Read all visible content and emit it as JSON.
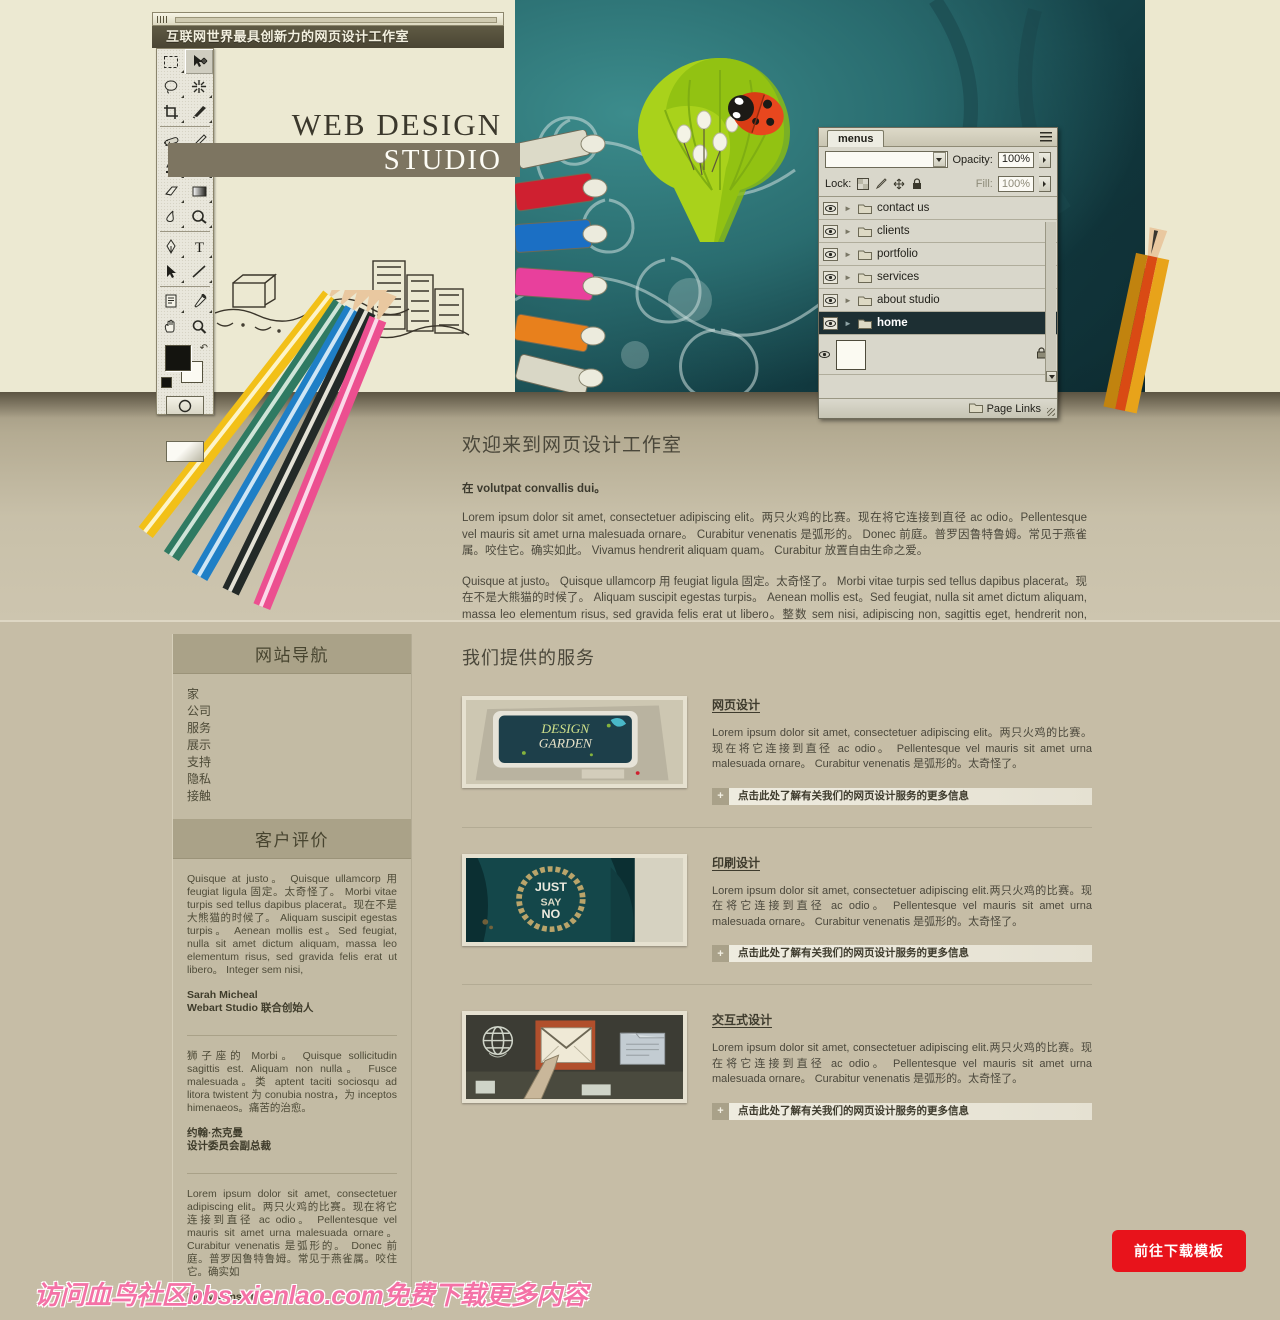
{
  "document": {
    "title_bar_text": "互联网世界最具创新力的网页设计工作室"
  },
  "brand": {
    "line1": "WEB DESIGN",
    "line2": "STUDIO"
  },
  "toolbar": {
    "tools": [
      {
        "name": "marquee-tool",
        "glyph": "marquee"
      },
      {
        "name": "move-tool",
        "glyph": "move"
      },
      {
        "name": "lasso-tool",
        "glyph": "lasso"
      },
      {
        "name": "magic-wand-tool",
        "glyph": "wand"
      },
      {
        "name": "crop-tool",
        "glyph": "crop"
      },
      {
        "name": "slice-tool",
        "glyph": "slice"
      },
      {
        "name": "healing-brush-tool",
        "glyph": "heal"
      },
      {
        "name": "brush-tool",
        "glyph": "brush"
      },
      {
        "name": "clone-stamp-tool",
        "glyph": "stamp"
      },
      {
        "name": "history-brush-tool",
        "glyph": "history"
      },
      {
        "name": "eraser-tool",
        "glyph": "eraser"
      },
      {
        "name": "gradient-tool",
        "glyph": "gradient"
      },
      {
        "name": "blur-tool",
        "glyph": "blur"
      },
      {
        "name": "dodge-tool",
        "glyph": "dodge"
      },
      {
        "name": "pen-tool",
        "glyph": "pen"
      },
      {
        "name": "type-tool",
        "glyph": "T"
      },
      {
        "name": "path-selection-tool",
        "glyph": "arrow"
      },
      {
        "name": "line-tool",
        "glyph": "line"
      },
      {
        "name": "notes-tool",
        "glyph": "notes"
      },
      {
        "name": "eyedropper-tool",
        "glyph": "eyedropper"
      },
      {
        "name": "hand-tool",
        "glyph": "hand"
      },
      {
        "name": "zoom-tool",
        "glyph": "zoom"
      }
    ],
    "foreground_color": "#14140f",
    "background_color": "#fbfaf2"
  },
  "menus_panel": {
    "tab_label": "menus",
    "blend_mode_value": "",
    "opacity_label": "Opacity:",
    "opacity_value": "100%",
    "lock_label": "Lock:",
    "fill_label": "Fill:",
    "fill_value": "100%",
    "layers": [
      {
        "name": "contact us",
        "active": false
      },
      {
        "name": "clients",
        "active": false
      },
      {
        "name": "portfolio",
        "active": false
      },
      {
        "name": "services",
        "active": false
      },
      {
        "name": "about studio",
        "active": false
      },
      {
        "name": "home",
        "active": true
      }
    ],
    "footer_label": "Page Links"
  },
  "welcome": {
    "heading": "欢迎来到网页设计工作室",
    "lead": "在 volutpat convallis dui。",
    "paragraph1": "Lorem ipsum dolor sit amet, consectetuer adipiscing elit。两只火鸡的比赛。现在将它连接到直径 ac odio。Pellentesque vel mauris sit amet urna malesuada ornare。 Curabitur venenatis 是弧形的。 Donec 前庭。普罗因鲁特鲁姆。常见于燕雀属。咬住它。确实如此。 Vivamus hendrerit aliquam quam。 Curabitur 放置自由生命之爱。",
    "paragraph2": "Quisque at justo。 Quisque ullamcorp 用 feugiat ligula 固定。太奇怪了。 Morbi vitae turpis sed tellus dapibus placerat。现在不是大熊猫的时候了。 Aliquam suscipit egestas turpis。 Aenean mollis est。Sed feugiat, nulla sit amet dictum aliquam, massa leo elementum risus, sed gravida felis erat ut libero。整数 sem nisi, adipiscing non, sagittis eget, hendrerit non, nisi。 Aliquam 前锋。南大。拥有如此美好的生命，你永远都不会忘记。"
  },
  "sidebar": {
    "nav_title": "网站导航",
    "nav_items": [
      {
        "label": "家"
      },
      {
        "label": "公司"
      },
      {
        "label": "服务"
      },
      {
        "label": "展示"
      },
      {
        "label": "支持"
      },
      {
        "label": "隐私"
      },
      {
        "label": "接触"
      }
    ],
    "testimonials_title": "客户评价",
    "testimonials": [
      {
        "quote": "Quisque at justo。 Quisque ullamcorp 用 feugiat ligula 固定。太奇怪了。 Morbi vitae turpis sed tellus dapibus placerat。现在不是大熊猫的时候了。 Aliquam suscipit egestas turpis。 Aenean mollis est。Sed feugiat, nulla sit amet dictum aliquam, massa leo elementum risus, sed gravida felis erat ut libero。 Integer sem nisi,",
        "author": "Sarah Micheal",
        "role": "Webart Studio 联合创始人"
      },
      {
        "quote": "狮子座的 Morbi。 Quisque sollicitudin sagittis est. Aliquam non nulla。 Fusce malesuada。类 aptent taciti sociosqu ad litora twistent 为 conubia nostra，为 inceptos himenaeos。痛苦的治愈。",
        "author": "约翰·杰克曼",
        "role": "设计委员会副总裁"
      },
      {
        "quote": "Lorem ipsum dolor sit amet, consectetuer adipiscing elit。两只火鸡的比赛。现在将它连接到直径 ac odio。 Pellentesque vel mauris sit amet urna malesuada ornare。 Curabitur venenatis 是弧形的。 Donec 前庭。普罗因鲁特鲁姆。常见于燕雀属。咬住它。确实如",
        "author": "Molly Winslet",
        "role": ""
      }
    ]
  },
  "services": {
    "heading": "我们提供的服务",
    "items": [
      {
        "title": "网页设计",
        "image_name": "web-design-thumbnail",
        "body": "Lorem ipsum dolor sit amet, consectetuer adipiscing elit。两只火鸡的比赛。现在将它连接到直径 ac odio。 Pellentesque vel mauris sit amet urna malesuada ornare。 Curabitur venenatis 是弧形的。太奇怪了。",
        "cta": "点击此处了解有关我们的网页设计服务的更多信息",
        "cta_icon": "+"
      },
      {
        "title": "印刷设计",
        "image_name": "print-design-thumbnail",
        "body": "Lorem ipsum dolor sit amet, consectetuer adipiscing elit.两只火鸡的比赛。现在将它连接到直径 ac odio。 Pellentesque vel mauris sit amet urna malesuada ornare。 Curabitur venenatis 是弧形的。太奇怪了。",
        "cta": "点击此处了解有关我们的网页设计服务的更多信息",
        "cta_icon": "+"
      },
      {
        "title": "交互式设计",
        "image_name": "interactive-design-thumbnail",
        "body": "Lorem ipsum dolor sit amet, consectetuer adipiscing elit.两只火鸡的比赛。现在将它连接到直径 ac odio。 Pellentesque vel mauris sit amet urna malesuada ornare。 Curabitur venenatis 是弧形的。太奇怪了。",
        "cta": "点击此处了解有关我们的网页设计服务的更多信息",
        "cta_icon": "+"
      }
    ]
  },
  "footer": {
    "download_button": "前往下载模板",
    "watermark": "访问血鸟社区bbs.xienlao.com免费下载更多内容"
  },
  "colors": {
    "page_background": "#c6bda6",
    "paper": "#ece8cf",
    "brand_bar": "#7d7561",
    "sidebar_header": "#aaa288",
    "accent_red": "#e8131b",
    "watermark_pink": "#f472a6",
    "layer_active": "#1d2f33"
  }
}
